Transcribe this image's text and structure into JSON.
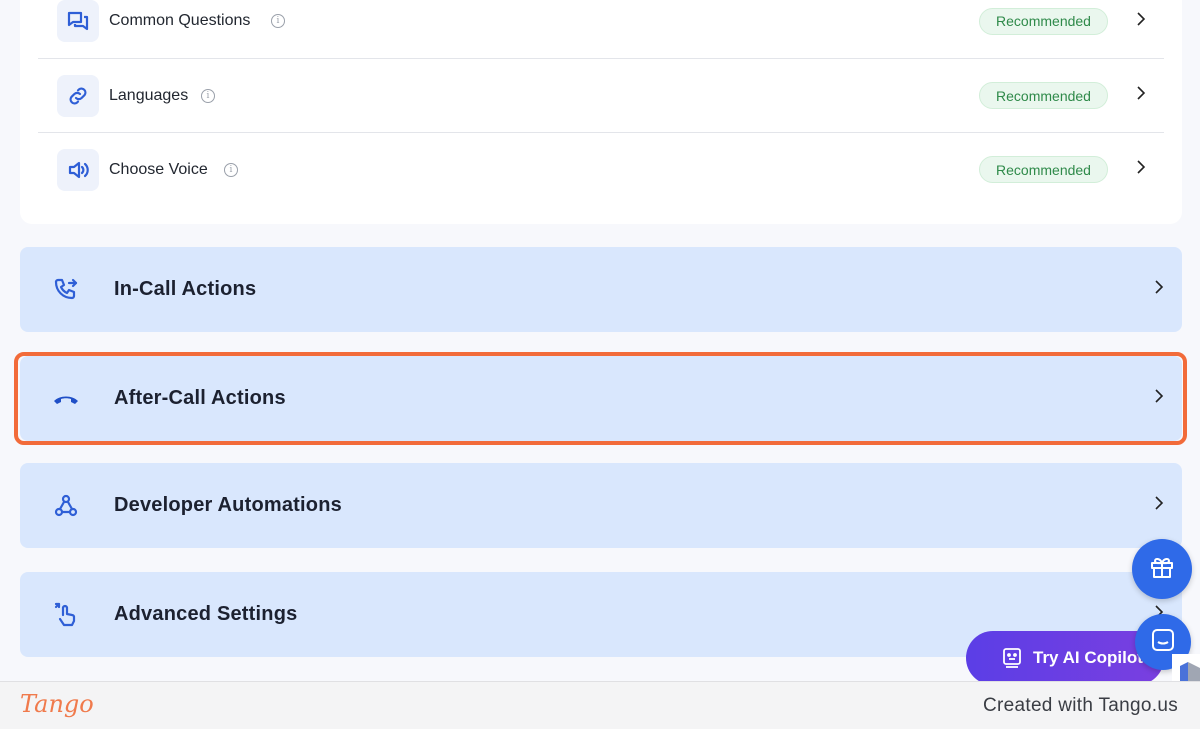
{
  "settings_rows": [
    {
      "label": "Common Questions",
      "icon": "chat-bubbles-icon",
      "badge": "Recommended"
    },
    {
      "label": "Languages",
      "icon": "link-icon",
      "badge": "Recommended"
    },
    {
      "label": "Choose Voice",
      "icon": "speaker-icon",
      "badge": "Recommended"
    }
  ],
  "info_glyph": "i",
  "sections": [
    {
      "label": "In-Call Actions",
      "icon": "phone-forward-icon"
    },
    {
      "label": "After-Call Actions",
      "icon": "phone-hangup-icon"
    },
    {
      "label": "Developer Automations",
      "icon": "webhook-icon"
    },
    {
      "label": "Advanced Settings",
      "icon": "tap-gesture-icon"
    }
  ],
  "highlighted_section": "After-Call Actions",
  "floating": {
    "copilot_label": "Try AI Copilot",
    "gift_icon": "gift-icon",
    "chat_icon": "chat-icon"
  },
  "footer": {
    "logo": "Tango",
    "text": "Created with Tango.us"
  },
  "colors": {
    "accent_blue": "#2f6ae8",
    "section_bg": "#d9e7fd",
    "highlight": "#f26b3a",
    "badge_text": "#2f8a4a",
    "badge_bg": "#eaf7ee",
    "copilot_purple": "#5b3ee6",
    "tango_orange": "#f07a4c"
  }
}
